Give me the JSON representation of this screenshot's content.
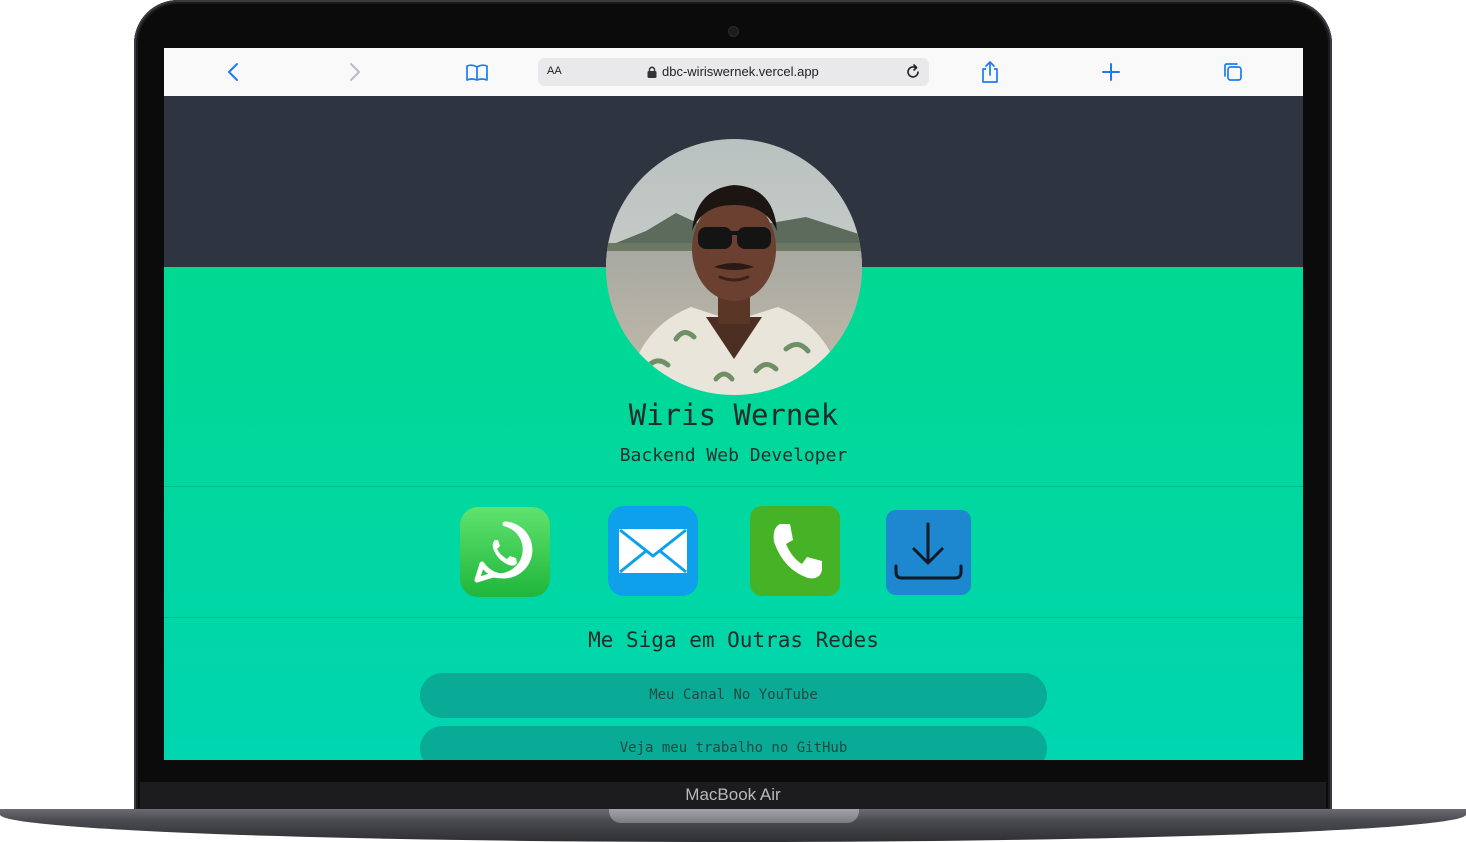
{
  "device": {
    "brand_label": "MacBook Air"
  },
  "browser": {
    "text_size_label": "AA",
    "url": "dbc-wiriswernek.vercel.app",
    "icons": [
      "back-icon",
      "forward-icon",
      "bookmarks-icon",
      "lock-icon",
      "reload-icon",
      "share-icon",
      "new-tab-icon",
      "tabs-icon"
    ]
  },
  "profile": {
    "name": "Wiris Wernek",
    "role": "Backend Web Developer"
  },
  "contact_buttons": [
    "whatsapp-icon",
    "email-icon",
    "phone-icon",
    "download-icon"
  ],
  "social": {
    "heading": "Me Siga em Outras Redes",
    "links": [
      {
        "label": "Meu Canal No YouTube"
      },
      {
        "label": "Veja meu trabalho no GitHub"
      }
    ]
  },
  "colors": {
    "hero_dark": "#2e3440",
    "page_green": "#00d98f",
    "link_button": "#0aab96",
    "whatsapp": "#2fcb4f",
    "email": "#0ea0ea",
    "phone": "#46b225",
    "download": "#1d87cf"
  }
}
